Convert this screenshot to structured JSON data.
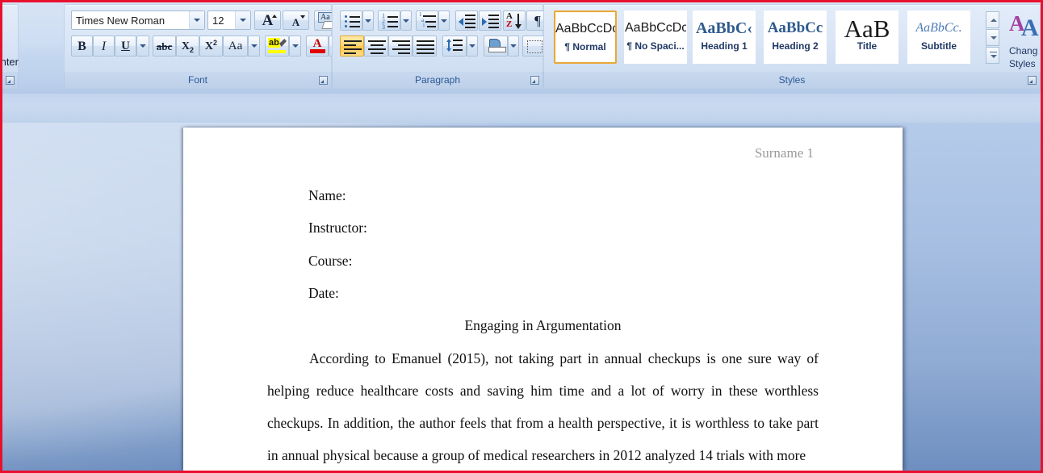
{
  "ribbon": {
    "clipboard": {
      "format_painter_label": "at Painter"
    },
    "font_group": {
      "label": "Font",
      "font_name": "Times New Roman",
      "font_size": "12",
      "grow_font": "A",
      "shrink_font": "A",
      "clear_formatting": "Aa",
      "bold": "B",
      "italic": "I",
      "underline": "U",
      "strikethrough": "abc",
      "subscript": "X",
      "subscript_sub": "2",
      "superscript": "X",
      "superscript_sup": "2",
      "change_case": "Aa",
      "highlight": "ab",
      "font_color": "A"
    },
    "paragraph_group": {
      "label": "Paragraph",
      "buttons": [
        "bullets",
        "numbering",
        "multilevel-list",
        "decrease-indent",
        "increase-indent",
        "sort",
        "show-formatting-marks",
        "align-left",
        "align-center",
        "align-right",
        "justify",
        "line-spacing",
        "shading",
        "borders"
      ]
    },
    "styles_group": {
      "label": "Styles",
      "items": [
        {
          "sample": "AaBbCcDc",
          "name": "¶ Normal",
          "selected": true
        },
        {
          "sample": "AaBbCcDc",
          "name": "¶ No Spaci...",
          "selected": false
        },
        {
          "sample": "AaBbC‹",
          "name": "Heading 1",
          "selected": false
        },
        {
          "sample": "AaBbCc",
          "name": "Heading 2",
          "selected": false
        },
        {
          "sample": "AaB",
          "name": "Title",
          "selected": false
        },
        {
          "sample": "AaBbCc.",
          "name": "Subtitle",
          "selected": false
        }
      ],
      "change_styles_line1": "Chang",
      "change_styles_line2": "Styles"
    }
  },
  "document": {
    "header": "Surname 1",
    "fields": [
      "Name:",
      "Instructor:",
      "Course:",
      "Date:"
    ],
    "title": "Engaging in Argumentation",
    "paragraph": "According to Emanuel (2015), not taking part in annual checkups is one sure way of helping reduce healthcare costs and saving him time and a lot of worry in these worthless checkups. In addition, the author feels that from a health perspective, it is worthless to take part in annual physical because a group of medical researchers in 2012 analyzed 14 trials with more"
  },
  "colors": {
    "accent_border": "#e8112d",
    "ribbon_label": "#2b5796",
    "selection_orange": "#e8a93b",
    "workspace_blue": "#8faad3"
  }
}
